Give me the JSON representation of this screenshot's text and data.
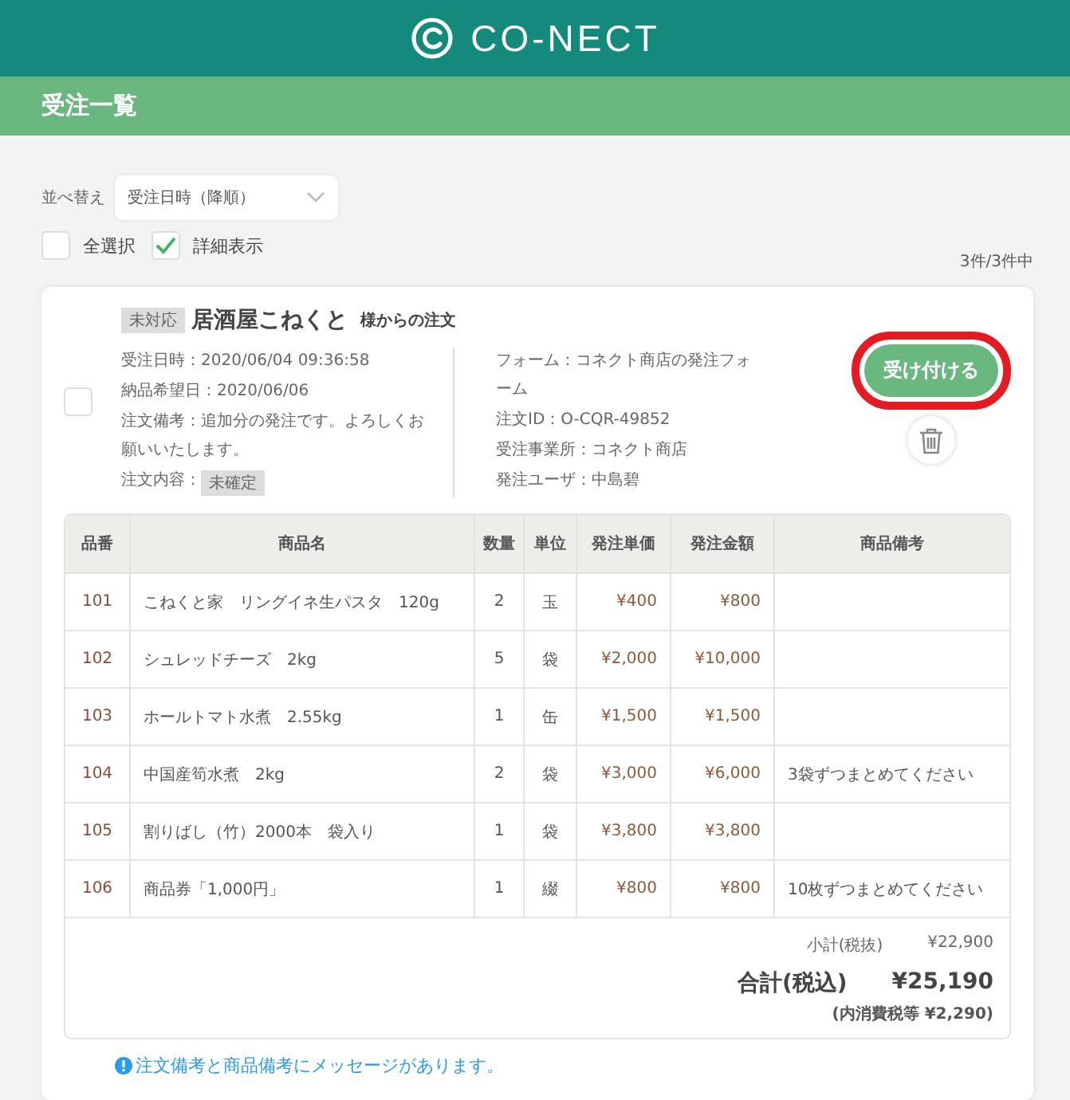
{
  "header": {
    "logo_text": "CO-NECT"
  },
  "page_title": "受注一覧",
  "sort": {
    "label": "並べ替え",
    "value": "受注日時（降順）"
  },
  "options": [
    {
      "label": "全選択",
      "checked": false
    },
    {
      "label": "詳細表示",
      "checked": true
    }
  ],
  "count": "3件/3件中",
  "order": {
    "checked": false,
    "status": "未対応",
    "customer": "居酒屋こねくと",
    "customer_suffix": "様からの注文",
    "left_fields": [
      "受注日時：2020/06/04 09:36:58",
      "納品希望日：2020/06/06",
      "注文備考：追加分の発注です。よろしくお願いいたします。"
    ],
    "content_label": "注文内容：",
    "content_status": "未確定",
    "right_fields": [
      "フォーム：コネクト商店の発注フォーム",
      "注文ID：O-CQR-49852",
      "受注事業所：コネクト商店",
      "発注ユーザ：中島碧"
    ],
    "accept_button": {
      "label": "受け付ける",
      "highlighted": true
    },
    "table": {
      "columns": [
        "品番",
        "商品名",
        "数量",
        "単位",
        "発注単価",
        "発注金額",
        "商品備考"
      ],
      "rows": [
        [
          "101",
          "こねくと家　リングイネ生パスタ　120g",
          "2",
          "玉",
          "¥400",
          "¥800",
          ""
        ],
        [
          "102",
          "シュレッドチーズ　2kg",
          "5",
          "袋",
          "¥2,000",
          "¥10,000",
          ""
        ],
        [
          "103",
          "ホールトマト水煮　2.55kg",
          "1",
          "缶",
          "¥1,500",
          "¥1,500",
          ""
        ],
        [
          "104",
          "中国産筍水煮　2kg",
          "2",
          "袋",
          "¥3,000",
          "¥6,000",
          "3袋ずつまとめてください"
        ],
        [
          "105",
          "割りばし（竹）2000本　袋入り",
          "1",
          "袋",
          "¥3,800",
          "¥3,800",
          ""
        ],
        [
          "106",
          "商品券「1,000円」",
          "1",
          "綴",
          "¥800",
          "¥800",
          "10枚ずつまとめてください"
        ]
      ]
    },
    "subtotal_label": "小計(税抜)",
    "subtotal": "¥22,900",
    "total_label": "合計(税込)",
    "total": "¥25,190",
    "tax_note": "(内消費税等 ¥2,290)",
    "notice": "注文備考と商品備考にメッセージがあります。"
  }
}
